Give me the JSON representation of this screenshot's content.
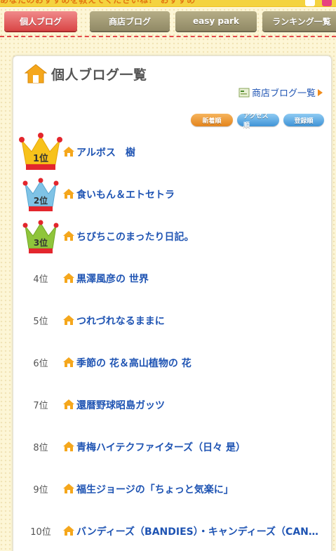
{
  "header": {
    "top_strip_text": "あなたのおすすめを教えてくださいね！ おすすめ",
    "tabs": [
      {
        "label": "個人ブログ",
        "active": true
      },
      {
        "label": "商店ブログ",
        "active": false
      },
      {
        "label": "easy park",
        "active": false
      },
      {
        "label": "ランキング一覧",
        "active": false
      }
    ]
  },
  "panel": {
    "title": "個人ブログ一覧",
    "shop_link_label": "商店ブログ一覧",
    "sort_buttons": [
      {
        "label": "新着順",
        "color": "orange"
      },
      {
        "label": "アクセス順",
        "color": "blue"
      },
      {
        "label": "登録順",
        "color": "blue"
      }
    ]
  },
  "ranking": [
    {
      "rank": "1位",
      "crown": "gold",
      "title": "アルボス　樹"
    },
    {
      "rank": "2位",
      "crown": "blue",
      "title": "食いもん＆エトセトラ"
    },
    {
      "rank": "3位",
      "crown": "green",
      "title": "ちびちこのまったり日記。"
    },
    {
      "rank": "4位",
      "crown": "",
      "title": "黒澤風彦の 世界"
    },
    {
      "rank": "5位",
      "crown": "",
      "title": "つれづれなるままに"
    },
    {
      "rank": "6位",
      "crown": "",
      "title": "季節の 花＆高山植物の 花"
    },
    {
      "rank": "7位",
      "crown": "",
      "title": "還暦野球昭島ガッツ"
    },
    {
      "rank": "8位",
      "crown": "",
      "title": "青梅ハイテクファイターズ（日々 是）"
    },
    {
      "rank": "9位",
      "crown": "",
      "title": "福生ジョージの「ちょっと気楽に」"
    },
    {
      "rank": "10位",
      "crown": "",
      "title": "バンディーズ（BANDIES）・キャンディーズ（CANDIE..."
    }
  ],
  "colors": {
    "background": "#fdf6d6",
    "link": "#1f54b3",
    "tab_active": "#d94646",
    "tab_inactive": "#918a66",
    "dash_line": "#e44a4a",
    "gold_crown": "#f7c21b",
    "blue_crown": "#7fc3e6",
    "green_crown": "#8fc53b",
    "crown_band": "#e3262d"
  },
  "icons": {
    "home": "home-icon",
    "arrow": "triangle-right-icon"
  }
}
